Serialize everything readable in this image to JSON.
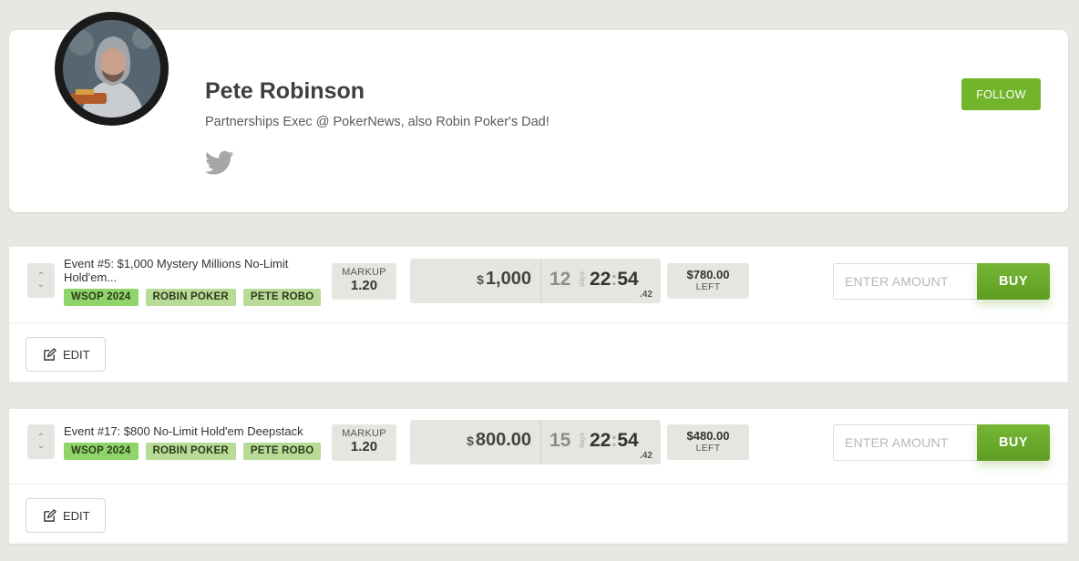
{
  "profile": {
    "name": "Pete Robinson",
    "bio": "Partnerships Exec @ PokerNews, also Robin Poker's Dad!",
    "follow_label": "FOLLOW",
    "social_icon": "twitter-icon"
  },
  "events": [
    {
      "title": "Event #5: $1,000 Mystery Millions No-Limit Hold'em...",
      "tags": [
        "WSOP 2024",
        "ROBIN POKER",
        "PETE ROBO"
      ],
      "markup_label": "MARKUP",
      "markup_value": "1.20",
      "price_currency": "$",
      "price": "1,000",
      "days": "12",
      "days_label": "days",
      "hours": "22",
      "minutes": "54",
      "seconds": ".42",
      "left_amount": "$780.00",
      "left_label": "LEFT",
      "amount_placeholder": "ENTER AMOUNT",
      "buy_label": "BUY",
      "edit_label": "EDIT"
    },
    {
      "title": "Event #17: $800 No-Limit Hold'em Deepstack",
      "tags": [
        "WSOP 2024",
        "ROBIN POKER",
        "PETE ROBO"
      ],
      "markup_label": "MARKUP",
      "markup_value": "1.20",
      "price_currency": "$",
      "price": "800.00",
      "days": "15",
      "days_label": "days",
      "hours": "22",
      "minutes": "54",
      "seconds": ".42",
      "left_amount": "$480.00",
      "left_label": "LEFT",
      "amount_placeholder": "ENTER AMOUNT",
      "buy_label": "BUY",
      "edit_label": "EDIT"
    }
  ],
  "colors": {
    "accent": "#72b52c",
    "tag_primary": "#8fd46a",
    "tag_secondary": "#b9db98",
    "background": "#e8e8e3"
  }
}
